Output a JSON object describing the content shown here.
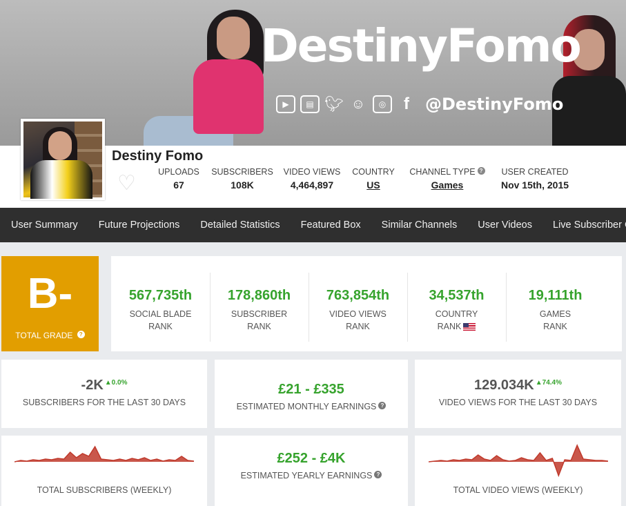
{
  "banner": {
    "brand_text": "DestinyFomo",
    "handle": "@DestinyFomo",
    "social_icons": [
      "youtube-icon",
      "twitch-icon",
      "twitter-icon",
      "snapchat-icon",
      "instagram-icon",
      "facebook-icon"
    ]
  },
  "profile": {
    "name": "Destiny Fomo",
    "stats": [
      {
        "label": "UPLOADS",
        "value": "67"
      },
      {
        "label": "SUBSCRIBERS",
        "value": "108K"
      },
      {
        "label": "VIDEO VIEWS",
        "value": "4,464,897"
      },
      {
        "label": "COUNTRY",
        "value": "US"
      },
      {
        "label": "CHANNEL TYPE",
        "value": "Games"
      },
      {
        "label": "USER CREATED",
        "value": "Nov 15th, 2015"
      }
    ]
  },
  "nav": {
    "items": [
      "User Summary",
      "Future Projections",
      "Detailed Statistics",
      "Featured Box",
      "Similar Channels",
      "User Videos",
      "Live Subscriber Count"
    ]
  },
  "grade": {
    "letter": "B-",
    "label": "TOTAL GRADE"
  },
  "ranks": [
    {
      "value": "567,735th",
      "line1": "SOCIAL BLADE",
      "line2": "RANK"
    },
    {
      "value": "178,860th",
      "line1": "SUBSCRIBER",
      "line2": "RANK"
    },
    {
      "value": "763,854th",
      "line1": "VIDEO VIEWS",
      "line2": "RANK"
    },
    {
      "value": "34,537th",
      "line1": "COUNTRY",
      "line2": "RANK"
    },
    {
      "value": "19,111th",
      "line1": "GAMES",
      "line2": "RANK"
    }
  ],
  "cards": {
    "subs30": {
      "value": "-2K",
      "change": "0.0%",
      "label": "SUBSCRIBERS FOR THE LAST 30 DAYS"
    },
    "monthly": {
      "value": "£21 - £335",
      "label": "ESTIMATED MONTHLY EARNINGS"
    },
    "views30": {
      "value": "129.034K",
      "change": "74.4%",
      "label": "VIDEO VIEWS FOR THE LAST 30 DAYS"
    },
    "subs_weekly": {
      "label": "TOTAL SUBSCRIBERS (WEEKLY)"
    },
    "yearly": {
      "value": "£252 - £4K",
      "label": "ESTIMATED YEARLY EARNINGS"
    },
    "views_weekly": {
      "label": "TOTAL VIDEO VIEWS (WEEKLY)"
    }
  },
  "colors": {
    "green": "#36a32d",
    "grade": "#e29e00",
    "nav": "#2f2f2f",
    "spark": "#c0392b"
  },
  "chart_data": [
    {
      "type": "area",
      "values": [
        0,
        0.2,
        0.1,
        0.3,
        0.2,
        0.4,
        0.3,
        0.5,
        0.4,
        1.4,
        0.6,
        1.2,
        0.8,
        2.2,
        0.4,
        0.3,
        0.2,
        0.4,
        0.2,
        0.5,
        0.3,
        0.6,
        0.2,
        0.4,
        0.1,
        0.3,
        0.2,
        0.8,
        0.2,
        0.1
      ]
    },
    {
      "type": "area",
      "values": [
        0,
        0.1,
        0.2,
        0.1,
        0.3,
        0.2,
        0.4,
        0.3,
        1.0,
        0.4,
        0.2,
        0.9,
        0.3,
        0.1,
        0.2,
        0.6,
        0.3,
        0.2,
        1.3,
        0.2,
        0.5,
        -2.0,
        0.3,
        0.2,
        2.4,
        0.4,
        0.3,
        0.2,
        0.2,
        0.1
      ]
    }
  ]
}
